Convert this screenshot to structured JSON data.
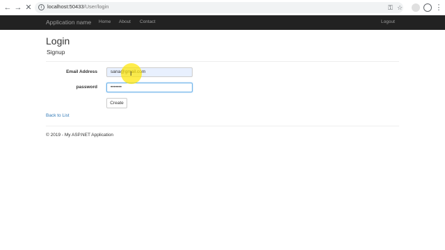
{
  "browser": {
    "url_host": "localhost:50433",
    "url_path": "/User/login"
  },
  "navbar": {
    "brand": "Application name",
    "links": [
      "Home",
      "About",
      "Contact"
    ],
    "logout": "Logout"
  },
  "page": {
    "title": "Login",
    "subtitle": "Signup"
  },
  "form": {
    "email_label": "Email Address",
    "email_value": "sana@gmail.com",
    "password_label": "password",
    "password_value": "•••••••",
    "create_label": "Create"
  },
  "back_link": "Back to List",
  "footer": "© 2019 - My ASP.NET Application",
  "colors": {
    "navbar": "#222222",
    "link": "#337ab7",
    "cursor_highlight": "#ffe600"
  }
}
